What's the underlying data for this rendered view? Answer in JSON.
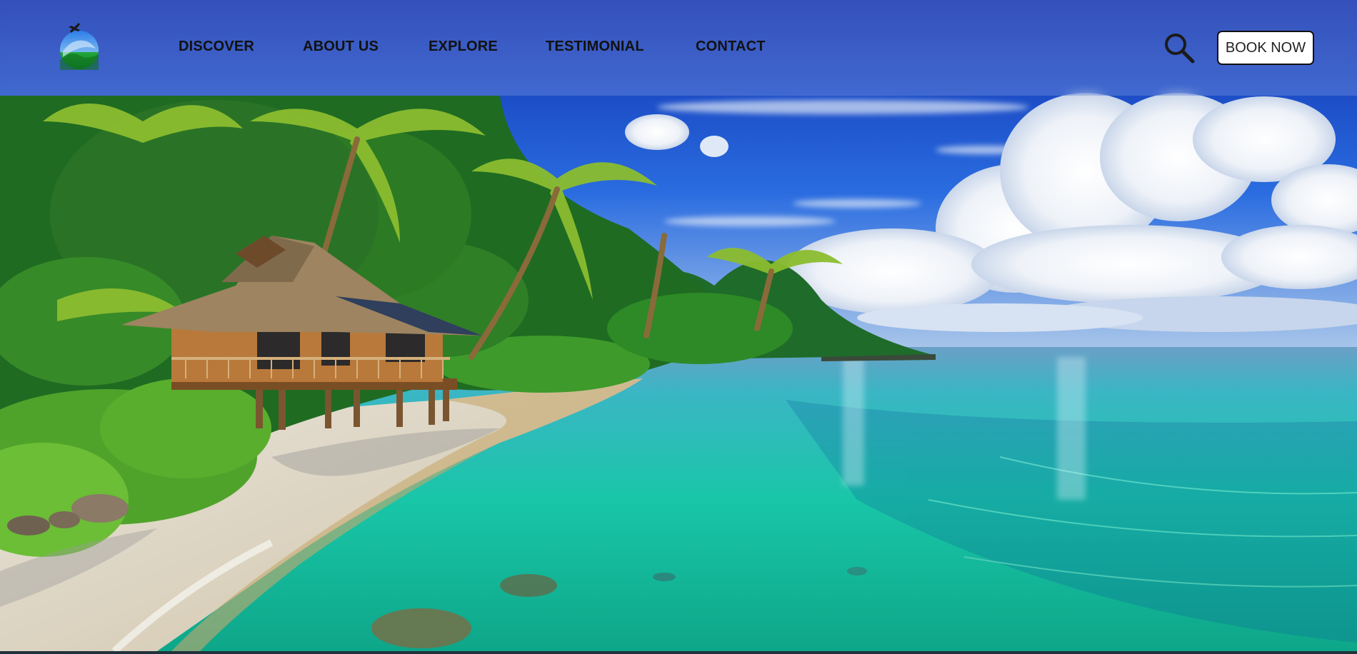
{
  "brand": {
    "logo_icon": "globe-plane-logo-icon"
  },
  "nav": {
    "links": [
      {
        "label": "DISCOVER"
      },
      {
        "label": "ABOUT US"
      },
      {
        "label": "EXPLORE"
      },
      {
        "label": "TESTIMONIAL"
      },
      {
        "label": "CONTACT"
      }
    ]
  },
  "actions": {
    "search_icon": "search-icon",
    "book_label": "BOOK NOW"
  },
  "hero": {
    "image": "tropical-beach-hut-lagoon"
  },
  "colors": {
    "nav_text": "#111111",
    "button_bg": "#ffffff",
    "button_border": "#111111",
    "sky": "#1c49c9",
    "water": "#1cc7a6"
  }
}
